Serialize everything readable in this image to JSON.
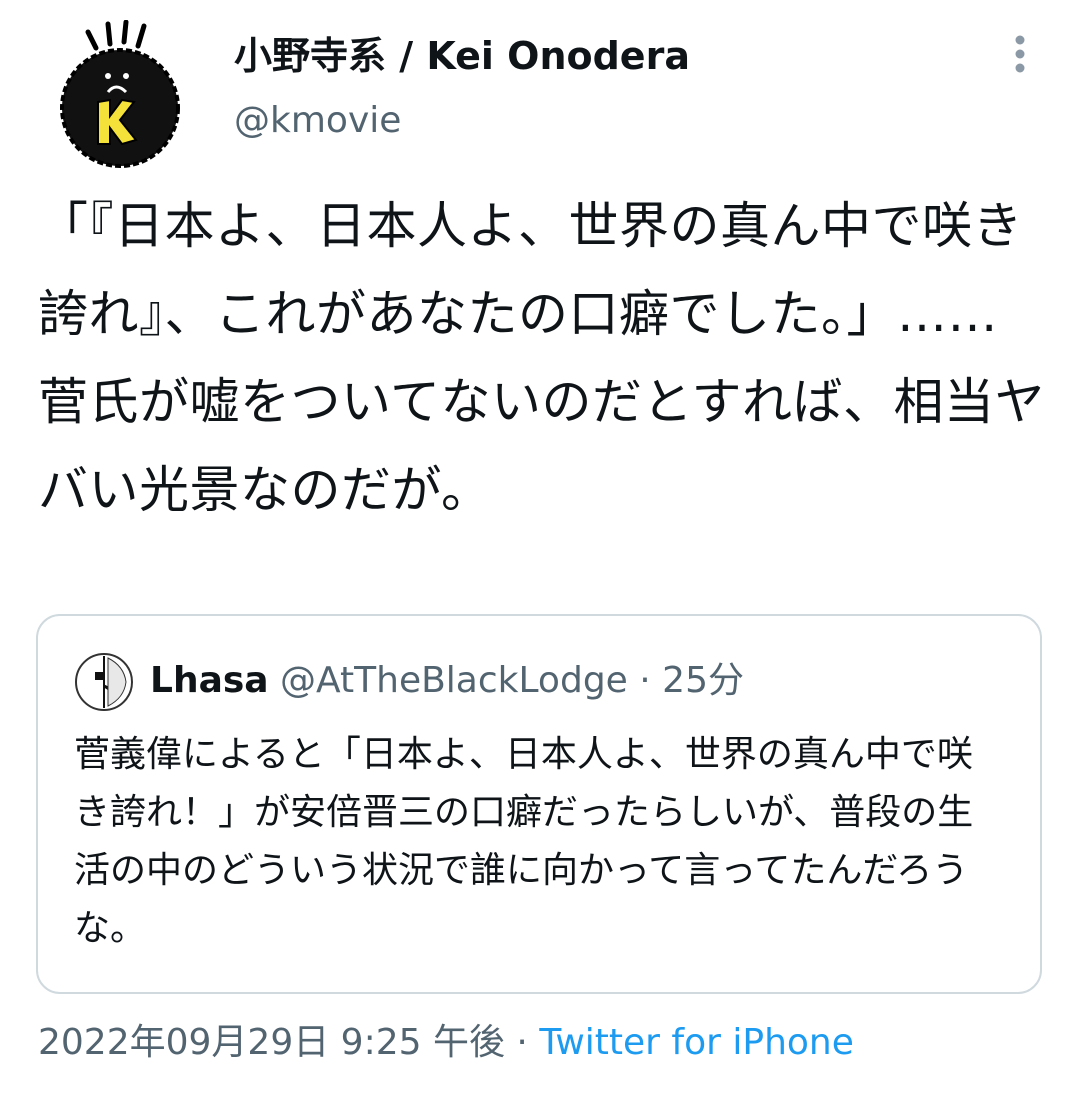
{
  "author": {
    "display_name": "小野寺系 / Kei Onodera",
    "handle": "@kmovie",
    "avatar_icon": "cartoon-k-face-avatar"
  },
  "more_icon": "vertical-ellipsis-icon",
  "tweet_text": "「『日本よ、日本人よ、世界の真ん中で咲き誇れ』、これがあなたの口癖でした。」……菅氏が嘘をついてないのだとすれば、相当ヤバい光景なのだが。",
  "quote": {
    "avatar_icon": "abstract-face-avatar",
    "name": "Lhasa",
    "handle": "@AtTheBlackLodge",
    "separator": "·",
    "time": "25分",
    "text": "菅義偉によると「日本よ、日本人よ、世界の真ん中で咲き誇れ！」が安倍晋三の口癖だったらしいが、普段の生活の中のどういう状況で誰に向かって言ってたんだろうな。"
  },
  "meta": {
    "timestamp": "2022年09月29日 9:25 午後",
    "separator": "·",
    "source": "Twitter for iPhone"
  },
  "colors": {
    "text_primary": "#0f1419",
    "text_secondary": "#536471",
    "link": "#1d9bf0",
    "border": "#cfd9de"
  }
}
